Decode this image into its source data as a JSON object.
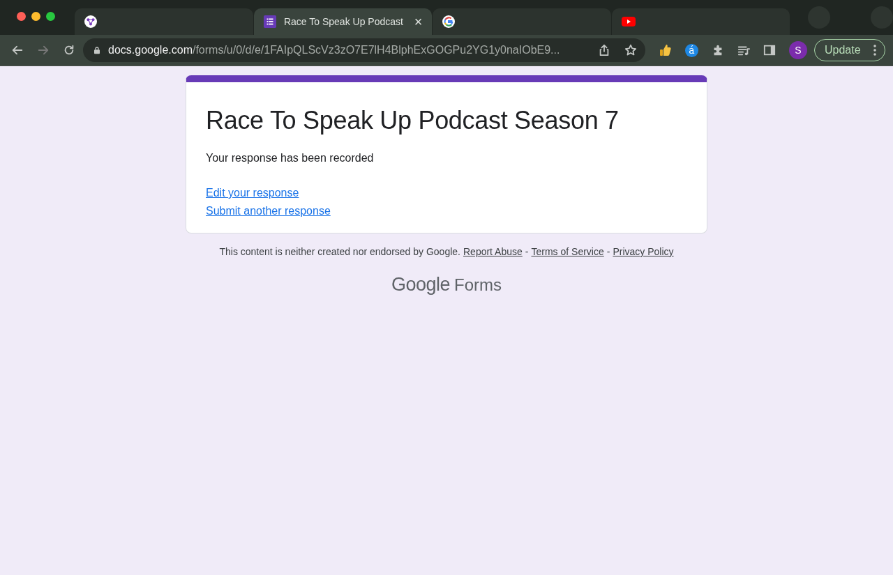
{
  "browser": {
    "tabs": [
      {
        "kind": "app",
        "selected": false
      },
      {
        "kind": "forms",
        "title": "Race To Speak Up Podcast",
        "selected": true,
        "close": "×"
      },
      {
        "kind": "google",
        "selected": false
      },
      {
        "kind": "video",
        "selected": false
      }
    ],
    "address": {
      "host": "docs.google.com",
      "path": "/forms/u/0/d/e/1FAIpQLScVz3zO7E7lH4BlphExGOGPu2YG1y0naIObE9..."
    },
    "extension_letter": "á",
    "profile_initial": "S",
    "update_button": "Update"
  },
  "form": {
    "title": "Race To Speak Up Podcast Season 7",
    "message": "Your response has been recorded",
    "links": [
      "Edit your response",
      "Submit another response"
    ]
  },
  "footer": {
    "notice": "This content is neither created nor endorsed by Google.",
    "links": [
      "Report Abuse",
      "Terms of Service",
      "Privacy Policy"
    ],
    "separator": "-",
    "logo_word": "Google",
    "logo_product": "Forms"
  }
}
